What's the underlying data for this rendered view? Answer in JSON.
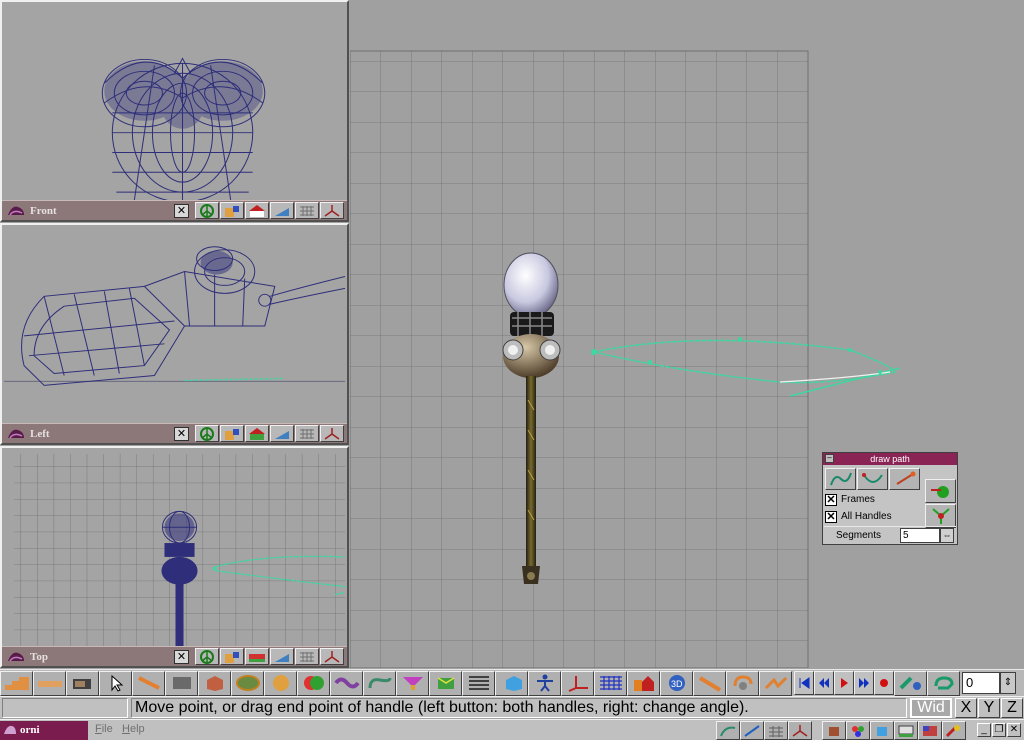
{
  "viewports": {
    "front": {
      "title": "Front"
    },
    "left": {
      "title": "Left"
    },
    "top": {
      "title": "Top"
    }
  },
  "viewport_bar_icons": [
    "peace-sign-icon",
    "cube-person-icon",
    "house-icon",
    "ramp-icon",
    "grid-pattern-icon",
    "axes-icon"
  ],
  "draw_path": {
    "title": "draw path",
    "frames_label": "Frames",
    "frames_checked": true,
    "all_handles_label": "All Handles",
    "all_handles_checked": true,
    "segments_label": "Segments",
    "segments_value": "5"
  },
  "toolbar": {
    "tools": [
      "stairs-tool-icon",
      "flat-tool-icon",
      "camera-tool-icon",
      "pointer-tool-icon",
      "move-tool-icon",
      "paint-tool-icon",
      "box-tool-icon",
      "disc-tool-icon",
      "sphere-tool-icon",
      "boolean-tool-icon",
      "lattice-tool-icon",
      "path-tool-icon",
      "funnel-tool-icon",
      "wrap-tool-icon",
      "list-tool-icon",
      "cube-tool-icon",
      "figure-tool-icon",
      "axes-tool-icon",
      "grid-tool-icon",
      "buildings-tool-icon",
      "3d-tool-icon",
      "bend-tool-icon",
      "spin-tool-icon",
      "deform-tool-icon"
    ],
    "playback": [
      "first-frame-icon",
      "rewind-icon",
      "play-icon",
      "fast-forward-icon",
      "record-icon",
      "keyframe-icon",
      "loop-icon"
    ],
    "frame_value": "0"
  },
  "status": {
    "message": "Move point, or drag end point of handle (left button: both handles, right: change angle).",
    "mode": "Wid",
    "axes": [
      "X",
      "Y",
      "Z"
    ]
  },
  "menubar": {
    "app_name": "orni",
    "menu": [
      {
        "label": "File",
        "underline": "F",
        "rest": "ile"
      },
      {
        "label": "Help",
        "underline": "H",
        "rest": "elp"
      }
    ]
  },
  "colors": {
    "viewport_bar": "#8c7878",
    "wireframe": "#2e2e7a",
    "path": "#3fd6a0",
    "panel_title": "#8a2455",
    "app_tag": "#7a1c4e"
  }
}
